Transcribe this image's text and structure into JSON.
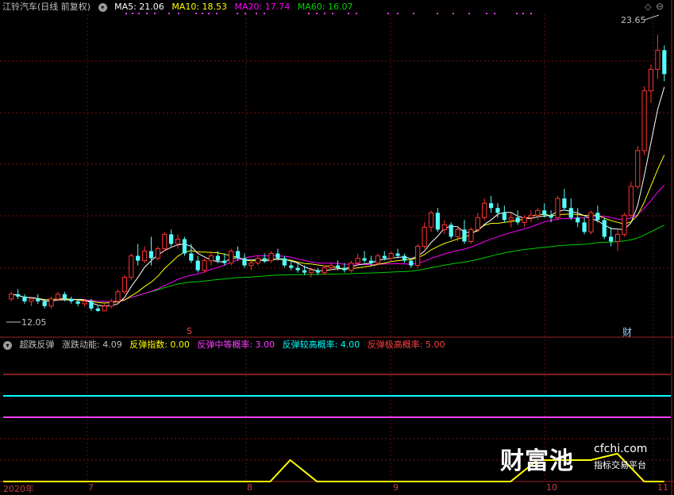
{
  "header": {
    "stock_name": "江铃汽车(日线 前复权)",
    "ma": [
      {
        "label": "MA5: 21.06",
        "color": "#ffffff"
      },
      {
        "label": "MA10: 18.53",
        "color": "#ffff00"
      },
      {
        "label": "MA20: 17.74",
        "color": "#ff00ff"
      },
      {
        "label": "MA60: 16.07",
        "color": "#00ff00"
      }
    ]
  },
  "price_panel": {
    "high_label": "23.65",
    "low_label": "12.05",
    "marker_s": "S",
    "marker_cai": "财"
  },
  "indicator": {
    "name": "超跌反弹",
    "items": [
      {
        "label": "涨跌动能: 4.09",
        "color": "#c0c0c0"
      },
      {
        "label": "反弹指数: 0.00",
        "color": "#ffff00"
      },
      {
        "label": "反弹中等概率: 3.00",
        "color": "#ff40ff"
      },
      {
        "label": "反弹较高概率: 4.00",
        "color": "#00ffff"
      },
      {
        "label": "反弹极高概率: 5.00",
        "color": "#ff4040"
      }
    ]
  },
  "x_axis": [
    "2020年",
    "7",
    "8",
    "9",
    "10",
    "11"
  ],
  "watermark": {
    "big": "财富池",
    "url": "cfchi.com",
    "sub": "指标交易平台"
  },
  "colors": {
    "up": "#ff3232",
    "down": "#54ffff",
    "ma5": "#ffffff",
    "ma10": "#ffff00",
    "ma20": "#ff00ff",
    "ma60": "#00d000"
  },
  "chart_data": {
    "type": "candlestick",
    "title": "江铃汽车(日线 前复权)",
    "ylim": [
      11.5,
      24.5
    ],
    "labels_marked": {
      "max": 23.65,
      "min": 12.05
    },
    "candles": [
      [
        12.6,
        12.9,
        12.5,
        12.8
      ],
      [
        12.8,
        13.0,
        12.6,
        12.7
      ],
      [
        12.7,
        12.8,
        12.4,
        12.5
      ],
      [
        12.5,
        12.7,
        12.3,
        12.6
      ],
      [
        12.6,
        12.8,
        12.4,
        12.5
      ],
      [
        12.5,
        12.6,
        12.2,
        12.3
      ],
      [
        12.3,
        12.7,
        12.2,
        12.6
      ],
      [
        12.6,
        12.9,
        12.5,
        12.8
      ],
      [
        12.8,
        12.9,
        12.5,
        12.6
      ],
      [
        12.6,
        12.7,
        12.4,
        12.5
      ],
      [
        12.5,
        12.6,
        12.3,
        12.4
      ],
      [
        12.4,
        12.6,
        12.3,
        12.5
      ],
      [
        12.5,
        12.6,
        12.1,
        12.2
      ],
      [
        12.2,
        12.3,
        12.05,
        12.1
      ],
      [
        12.1,
        12.4,
        12.1,
        12.3
      ],
      [
        12.3,
        12.6,
        12.2,
        12.5
      ],
      [
        12.5,
        13.0,
        12.4,
        12.9
      ],
      [
        12.9,
        13.6,
        12.8,
        13.5
      ],
      [
        13.5,
        14.5,
        13.4,
        14.4
      ],
      [
        14.4,
        14.9,
        14.0,
        14.2
      ],
      [
        14.2,
        14.8,
        14.1,
        14.6
      ],
      [
        14.6,
        15.2,
        14.0,
        14.3
      ],
      [
        14.3,
        14.8,
        14.2,
        14.7
      ],
      [
        14.7,
        15.4,
        14.6,
        15.3
      ],
      [
        15.3,
        15.5,
        14.8,
        14.9
      ],
      [
        14.9,
        15.3,
        14.7,
        15.1
      ],
      [
        15.1,
        15.2,
        14.4,
        14.5
      ],
      [
        14.5,
        14.9,
        14.1,
        14.2
      ],
      [
        14.2,
        14.4,
        13.7,
        13.8
      ],
      [
        13.8,
        14.3,
        13.7,
        14.2
      ],
      [
        14.2,
        14.6,
        14.0,
        14.4
      ],
      [
        14.4,
        14.6,
        14.1,
        14.2
      ],
      [
        14.2,
        14.5,
        14.0,
        14.1
      ],
      [
        14.1,
        14.7,
        14.0,
        14.6
      ],
      [
        14.6,
        14.8,
        14.2,
        14.3
      ],
      [
        14.3,
        14.5,
        13.9,
        14.0
      ],
      [
        14.0,
        14.3,
        13.8,
        14.1
      ],
      [
        14.1,
        14.4,
        14.0,
        14.3
      ],
      [
        14.3,
        14.5,
        14.1,
        14.2
      ],
      [
        14.2,
        14.6,
        14.1,
        14.5
      ],
      [
        14.5,
        14.7,
        14.2,
        14.3
      ],
      [
        14.3,
        14.4,
        13.9,
        14.0
      ],
      [
        14.0,
        14.2,
        13.8,
        13.9
      ],
      [
        13.9,
        14.1,
        13.7,
        13.8
      ],
      [
        13.8,
        14.0,
        13.6,
        13.7
      ],
      [
        13.7,
        13.9,
        13.5,
        13.8
      ],
      [
        13.8,
        13.9,
        13.6,
        13.7
      ],
      [
        13.7,
        14.0,
        13.6,
        13.9
      ],
      [
        13.9,
        14.1,
        13.8,
        14.0
      ],
      [
        14.0,
        14.2,
        13.8,
        13.9
      ],
      [
        13.9,
        14.1,
        13.7,
        13.8
      ],
      [
        13.8,
        14.2,
        13.7,
        14.1
      ],
      [
        14.1,
        14.5,
        14.0,
        14.3
      ],
      [
        14.3,
        14.6,
        14.1,
        14.2
      ],
      [
        14.2,
        14.4,
        14.0,
        14.1
      ],
      [
        14.1,
        14.5,
        14.0,
        14.4
      ],
      [
        14.4,
        14.6,
        14.2,
        14.3
      ],
      [
        14.3,
        14.6,
        14.2,
        14.5
      ],
      [
        14.5,
        14.7,
        14.3,
        14.4
      ],
      [
        14.4,
        14.5,
        14.1,
        14.2
      ],
      [
        14.2,
        14.3,
        13.9,
        14.0
      ],
      [
        14.0,
        14.9,
        13.9,
        14.8
      ],
      [
        14.8,
        15.8,
        14.7,
        15.6
      ],
      [
        15.6,
        16.3,
        15.4,
        16.2
      ],
      [
        16.2,
        16.4,
        15.4,
        15.5
      ],
      [
        15.5,
        15.9,
        15.3,
        15.7
      ],
      [
        15.7,
        15.8,
        15.1,
        15.2
      ],
      [
        15.2,
        15.6,
        15.0,
        15.5
      ],
      [
        15.5,
        15.9,
        14.9,
        15.0
      ],
      [
        15.0,
        15.6,
        14.9,
        15.5
      ],
      [
        15.5,
        16.2,
        15.4,
        16.0
      ],
      [
        16.0,
        16.8,
        15.9,
        16.6
      ],
      [
        16.6,
        16.9,
        16.2,
        16.4
      ],
      [
        16.4,
        16.6,
        16.0,
        16.2
      ],
      [
        16.2,
        16.5,
        15.8,
        15.9
      ],
      [
        15.9,
        16.2,
        15.6,
        16.0
      ],
      [
        16.0,
        16.3,
        15.7,
        15.8
      ],
      [
        15.8,
        16.1,
        15.6,
        16.0
      ],
      [
        16.0,
        16.3,
        15.8,
        16.1
      ],
      [
        16.1,
        16.4,
        15.9,
        16.3
      ],
      [
        16.3,
        16.6,
        16.0,
        16.1
      ],
      [
        16.1,
        16.3,
        15.8,
        16.0
      ],
      [
        16.0,
        16.9,
        15.9,
        16.8
      ],
      [
        16.8,
        17.2,
        16.3,
        16.4
      ],
      [
        16.4,
        16.8,
        15.9,
        16.0
      ],
      [
        16.0,
        16.4,
        15.6,
        15.8
      ],
      [
        15.8,
        16.0,
        15.3,
        15.4
      ],
      [
        15.4,
        16.3,
        15.3,
        16.2
      ],
      [
        16.2,
        16.5,
        15.8,
        15.9
      ],
      [
        15.9,
        16.0,
        15.1,
        15.2
      ],
      [
        15.2,
        15.6,
        14.8,
        15.0
      ],
      [
        15.0,
        15.5,
        14.6,
        15.3
      ],
      [
        15.3,
        16.2,
        15.2,
        16.1
      ],
      [
        16.1,
        17.5,
        16.0,
        17.3
      ],
      [
        17.3,
        19.0,
        17.2,
        18.8
      ],
      [
        18.8,
        21.5,
        18.6,
        21.3
      ],
      [
        21.3,
        22.4,
        20.8,
        22.2
      ],
      [
        22.2,
        23.65,
        21.8,
        23.0
      ],
      [
        23.0,
        23.2,
        21.7,
        22.0
      ]
    ],
    "indicator_series": {
      "name": "反弹指数",
      "levels": {
        "中等概率": 3.0,
        "较高概率": 4.0,
        "极高概率": 5.0
      },
      "ylim": [
        0,
        6
      ],
      "points": [
        [
          0,
          0
        ],
        [
          0.4,
          0
        ],
        [
          0.43,
          1.0
        ],
        [
          0.47,
          0
        ],
        [
          0.76,
          0
        ],
        [
          0.8,
          1.0
        ],
        [
          0.88,
          1.0
        ],
        [
          0.92,
          1.3
        ],
        [
          0.96,
          0
        ],
        [
          0.99,
          0
        ]
      ]
    }
  }
}
